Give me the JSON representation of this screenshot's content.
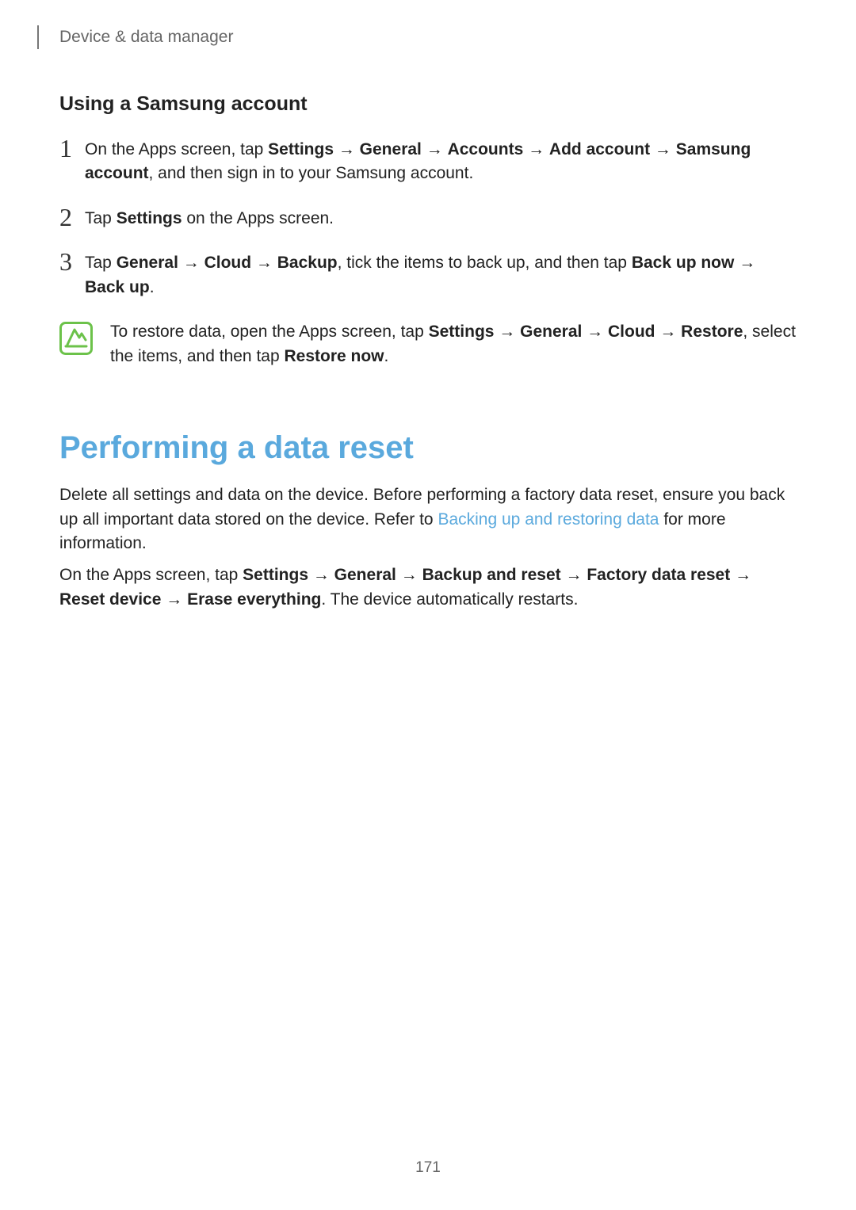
{
  "header": {
    "section_label": "Device & data manager"
  },
  "subsection": {
    "title": "Using a Samsung account"
  },
  "steps": {
    "s1": {
      "num": "1",
      "prefix": "On the Apps screen, tap ",
      "b1": "Settings",
      "arrow": " → ",
      "b2": "General",
      "b3": "Accounts",
      "b4": "Add account",
      "b5": "Samsung account",
      "suffix": ", and then sign in to your Samsung account."
    },
    "s2": {
      "num": "2",
      "prefix": "Tap ",
      "b1": "Settings",
      "suffix": " on the Apps screen."
    },
    "s3": {
      "num": "3",
      "prefix": "Tap ",
      "b1": "General",
      "arrow": " → ",
      "b2": "Cloud",
      "b3": "Backup",
      "mid": ", tick the items to back up, and then tap ",
      "b4": "Back up now",
      "b5": "Back up",
      "suffix": "."
    }
  },
  "note": {
    "prefix": "To restore data, open the Apps screen, tap ",
    "b1": "Settings",
    "arrow": " → ",
    "b2": "General",
    "b3": "Cloud",
    "b4": "Restore",
    "mid": ", select the items, and then tap ",
    "b5": "Restore now",
    "suffix": "."
  },
  "section2": {
    "title": "Performing a data reset",
    "p1_a": "Delete all settings and data on the device. Before performing a factory data reset, ensure you back up all important data stored on the device. Refer to ",
    "p1_link": "Backing up and restoring data",
    "p1_b": " for more information.",
    "p2_prefix": "On the Apps screen, tap ",
    "p2_b1": "Settings",
    "arrow": " → ",
    "p2_b2": "General",
    "p2_b3": "Backup and reset",
    "p2_b4": "Factory data reset",
    "p2_b5": "Reset device",
    "p2_b6": "Erase everything",
    "p2_suffix": ". The device automatically restarts."
  },
  "page_number": "171"
}
